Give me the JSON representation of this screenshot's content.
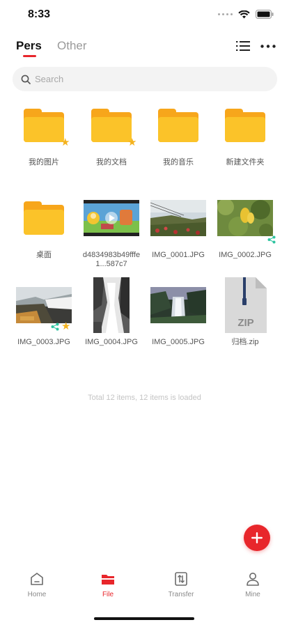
{
  "status_bar": {
    "time": "8:33"
  },
  "header": {
    "tabs": [
      {
        "label": "Pers",
        "active": true
      },
      {
        "label": "Other",
        "active": false
      }
    ]
  },
  "search": {
    "placeholder": "Search"
  },
  "items": [
    {
      "label": "我的图片",
      "kind": "folder",
      "starred": true
    },
    {
      "label": "我的文档",
      "kind": "folder",
      "starred": true
    },
    {
      "label": "我的音乐",
      "kind": "folder",
      "starred": false
    },
    {
      "label": "新建文件夹",
      "kind": "folder",
      "starred": false
    },
    {
      "label": "桌面",
      "kind": "folder",
      "starred": false
    },
    {
      "label": "d4834983b49fffe1...587c7",
      "kind": "video"
    },
    {
      "label": "IMG_0001.JPG",
      "kind": "photo"
    },
    {
      "label": "IMG_0002.JPG",
      "kind": "photo",
      "shared": true
    },
    {
      "label": "IMG_0003.JPG",
      "kind": "photo",
      "shared": true,
      "starred": true
    },
    {
      "label": "IMG_0004.JPG",
      "kind": "photo"
    },
    {
      "label": "IMG_0005.JPG",
      "kind": "photo"
    },
    {
      "label": "归档.zip",
      "kind": "zip",
      "badge": "ZIP"
    }
  ],
  "footer_text": "Total 12 items, 12 items is loaded",
  "bottom_nav": [
    {
      "label": "Home",
      "icon": "home-icon",
      "active": false
    },
    {
      "label": "File",
      "icon": "file-icon",
      "active": true
    },
    {
      "label": "Transfer",
      "icon": "transfer-icon",
      "active": false
    },
    {
      "label": "Mine",
      "icon": "person-icon",
      "active": false
    }
  ],
  "colors": {
    "accent": "#e8262b",
    "folder": "#fbc329",
    "star": "#f4b21e",
    "share": "#2ec4a0"
  }
}
